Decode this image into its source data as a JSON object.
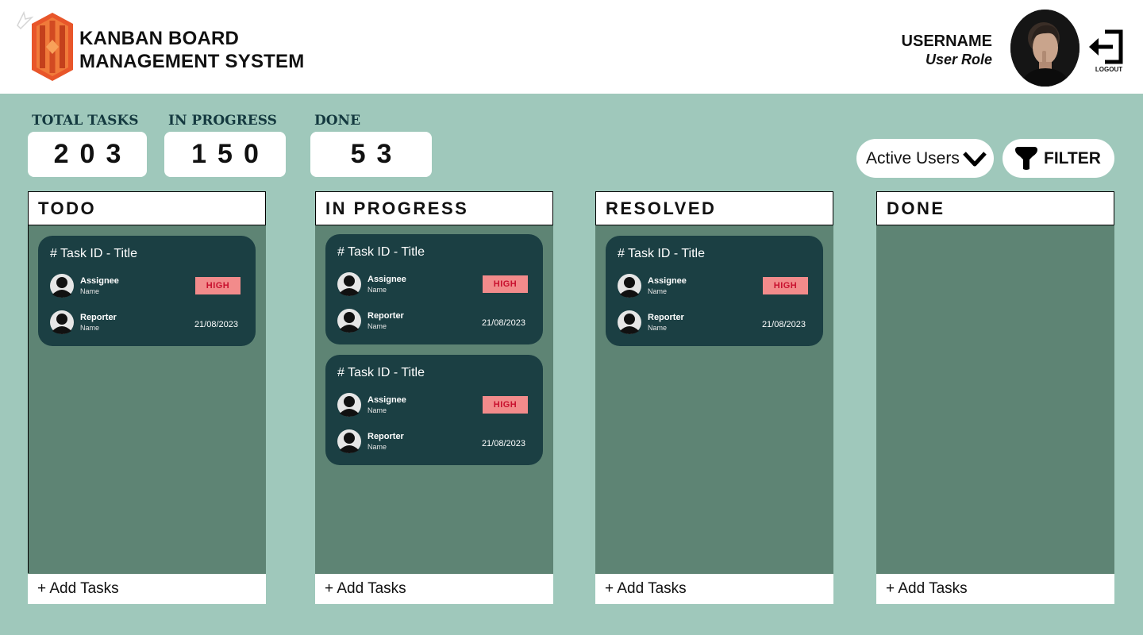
{
  "header": {
    "title_line1": "KANBAN BOARD",
    "title_line2": "MANAGEMENT SYSTEM",
    "username": "USERNAME",
    "user_role": "User Role",
    "logout_label": "LOGOUT",
    "brand_color": "#e8562a"
  },
  "stats": [
    {
      "label": "TOTAL TASKS",
      "value": "203"
    },
    {
      "label": "IN PROGRESS",
      "value": "150"
    },
    {
      "label": "DONE",
      "value": "53"
    }
  ],
  "controls": {
    "active_users_label": "Active Users",
    "filter_label": "FILTER"
  },
  "columns": [
    {
      "title": "TODO",
      "add_label": "+ Add Tasks",
      "cards": [
        {
          "title": "# Task ID - Title",
          "assignee_label": "Assignee",
          "assignee_name": "Name",
          "reporter_label": "Reporter",
          "reporter_name": "Name",
          "priority": "HIGH",
          "date": "21/08/2023"
        }
      ]
    },
    {
      "title": "IN PROGRESS",
      "add_label": "+ Add Tasks",
      "cards": [
        {
          "title": "# Task ID - Title",
          "assignee_label": "Assignee",
          "assignee_name": "Name",
          "reporter_label": "Reporter",
          "reporter_name": "Name",
          "priority": "HIGH",
          "date": "21/08/2023"
        },
        {
          "title": "# Task ID - Title",
          "assignee_label": "Assignee",
          "assignee_name": "Name",
          "reporter_label": "Reporter",
          "reporter_name": "Name",
          "priority": "HIGH",
          "date": "21/08/2023"
        }
      ]
    },
    {
      "title": "RESOLVED",
      "add_label": "+ Add Tasks",
      "cards": [
        {
          "title": "# Task ID - Title",
          "assignee_label": "Assignee",
          "assignee_name": "Name",
          "reporter_label": "Reporter",
          "reporter_name": "Name",
          "priority": "HIGH",
          "date": "21/08/2023"
        }
      ]
    },
    {
      "title": "DONE",
      "add_label": "+ Add Tasks",
      "cards": []
    }
  ],
  "colors": {
    "board_bg": "#9fc8bb",
    "column_bg": "#5e8474",
    "card_bg": "#1b3f43",
    "priority_bg": "#f28b8b",
    "priority_text": "#c8102e"
  }
}
